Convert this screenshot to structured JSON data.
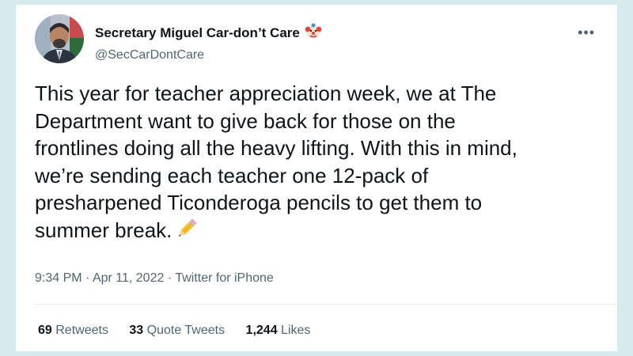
{
  "tweet": {
    "author": {
      "display_name": "Secretary Miguel Car-don’t Care",
      "handle": "@SecCarDontCare",
      "name_emoji": "clown-face-icon"
    },
    "text": "This year for teacher appreciation week, we at The\nDepartment want to give back for those on the\nfrontlines doing all the heavy lifting. With this in mind,\nwe’re sending each teacher one 12-pack of\npresharpened Ticonderoga pencils to get them to\nsummer break.",
    "text_emoji": "pencil-icon",
    "meta": {
      "time": "9:34 PM",
      "separator1": " · ",
      "date": "Apr 11, 2022",
      "separator2": " · ",
      "source": "Twitter for iPhone"
    },
    "stats": {
      "retweets_count": "69",
      "retweets_label": "Retweets",
      "quotes_count": "33",
      "quotes_label": "Quote Tweets",
      "likes_count": "1,244",
      "likes_label": "Likes"
    }
  },
  "colors": {
    "background": "#d6ebee",
    "card": "#ffffff",
    "text_primary": "#0f1419",
    "text_secondary": "#536471"
  }
}
